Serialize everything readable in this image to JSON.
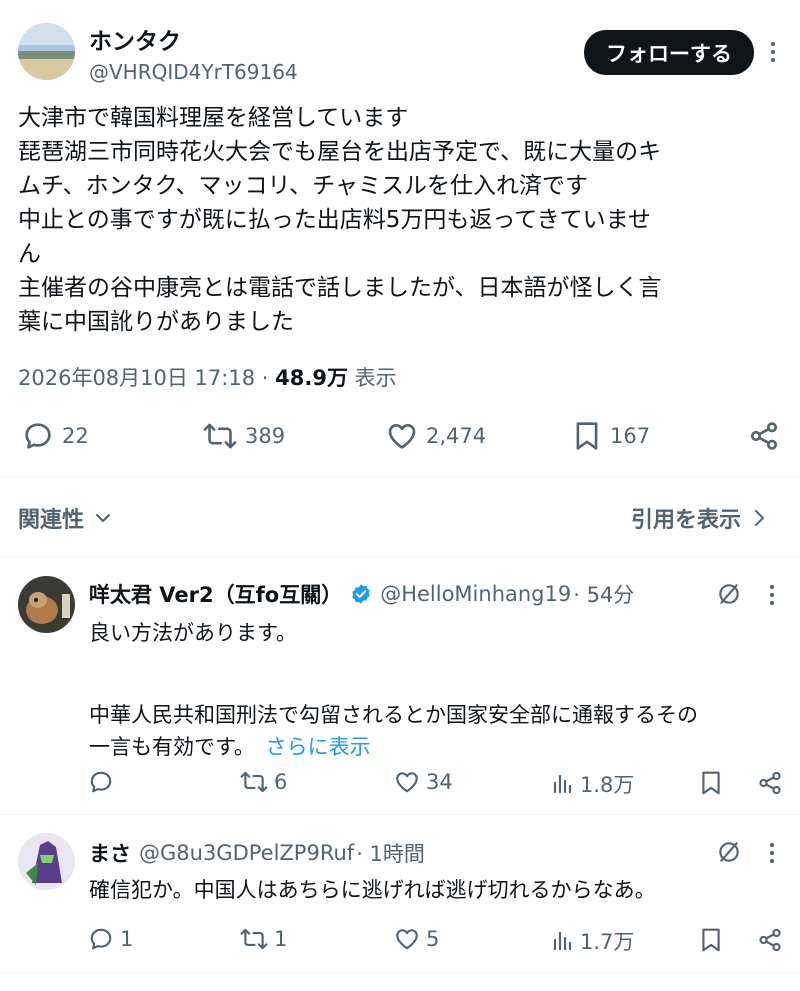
{
  "tweet": {
    "author_name": "ホンタク",
    "handle": "@VHRQID4YrT69164",
    "follow_label": "フォローする",
    "lines": [
      "大津市で韓国料理屋を経営しています",
      "琵琶湖三市同時花火大会でも屋台を出店予定で、既に大量のキ",
      "ムチ、ホンタク、マッコリ、チャミスルを仕入れ済です",
      "中止との事ですが既に払った出店料5万円も返ってきていませ",
      "ん",
      "主催者の谷中康亮とは電話で話しましたが、日本語が怪しく言",
      "葉に中国訛りがありました"
    ],
    "timestamp": "2026年08月10日 17:18",
    "dot": "·",
    "views_count": "48.9万",
    "views_label": "表示",
    "stats": {
      "replies": "22",
      "retweets": "389",
      "likes": "2,474",
      "bookmarks": "167"
    }
  },
  "filter_bar": {
    "relevance_label": "関連性",
    "quotes_label": "引用を表示"
  },
  "replies": [
    {
      "name": "咩太君 Ver2（互fo互關）",
      "handle": "@HelloMinhang19",
      "time": "· 54分",
      "verified": true,
      "text_lines": [
        "良い方法があります。",
        "",
        "中華人民共和国刑法で勾留されるとか国家安全部に通報するその"
      ],
      "last_line": "一言も有効です。",
      "more_label": "さらに表示",
      "stats": {
        "replies": "",
        "retweets": "6",
        "likes": "34",
        "views": "1.8万"
      }
    },
    {
      "name": "まさ",
      "handle": "@G8u3GDPelZP9Ruf",
      "time": "· 1時間",
      "verified": false,
      "text_lines": [
        "確信犯か。中国人はあちらに逃げれば逃げ切れるからなあ。"
      ],
      "stats": {
        "replies": "1",
        "retweets": "1",
        "likes": "5",
        "views": "1.7万"
      }
    }
  ],
  "colors": {
    "accent": "#1d9bf0",
    "text": "#0f1419",
    "muted": "#536471",
    "verified": "#1d9bf0"
  },
  "icons": [
    "reply-icon",
    "retweet-icon",
    "like-icon",
    "bookmark-icon",
    "share-icon",
    "views-icon",
    "grok-icon",
    "more-icon",
    "chevron-down-icon",
    "chevron-right-icon",
    "verified-badge-icon"
  ]
}
